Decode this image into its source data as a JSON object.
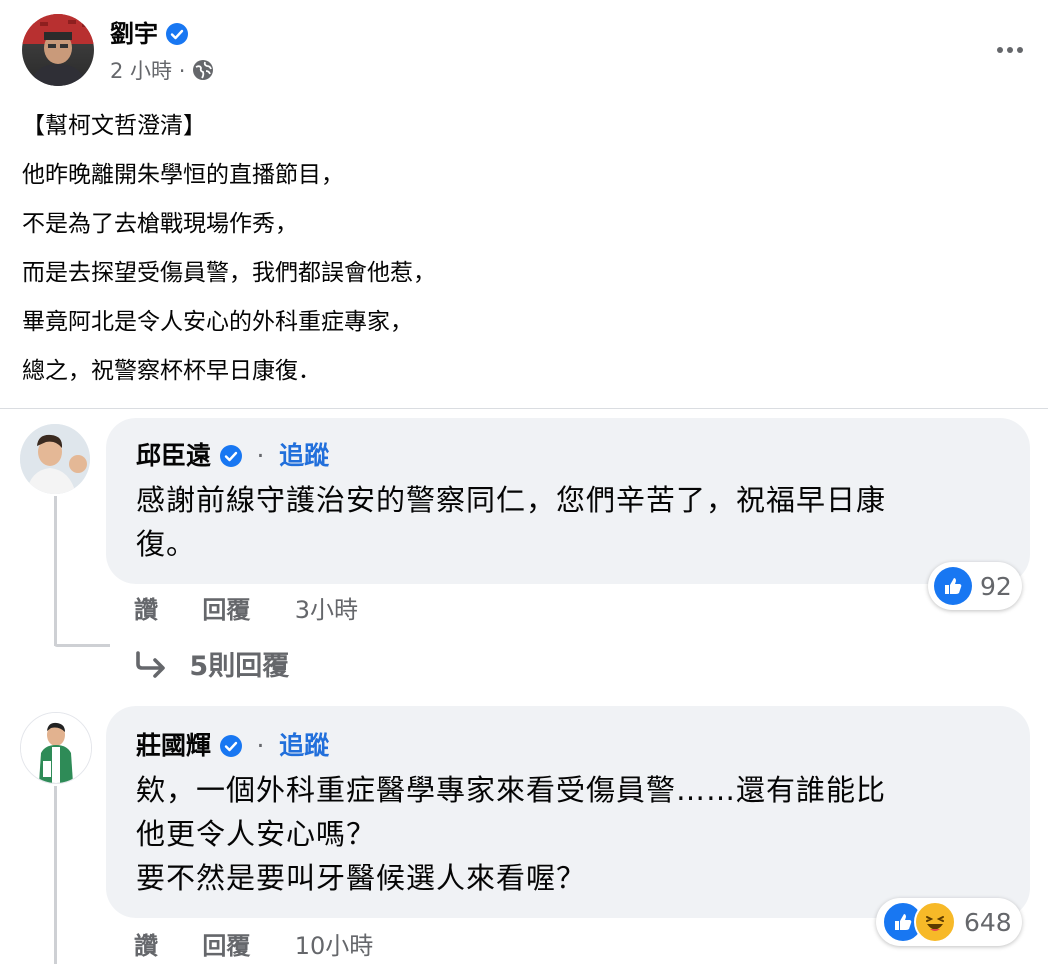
{
  "post": {
    "author": "劉宇",
    "time": "2 小時",
    "meta_sep": "·",
    "lines": [
      "【幫柯文哲澄清】",
      "他昨晚離開朱學恒的直播節目，",
      "不是為了去槍戰現場作秀，",
      "而是去探望受傷員警，我們都誤會他惹，",
      "畢竟阿北是令人安心的外科重症專家，",
      "總之，祝警察杯杯早日康復．"
    ]
  },
  "comments": [
    {
      "name": "邱臣遠",
      "sep": "·",
      "follow": "追蹤",
      "lines": [
        "感謝前線守護治安的警察同仁，您們辛苦了，祝福早日康",
        "復。"
      ],
      "like": "讚",
      "reply": "回覆",
      "time": "3小時",
      "reaction_count": "92",
      "replies_label": "5則回覆"
    },
    {
      "name": "莊國輝",
      "sep": "·",
      "follow": "追蹤",
      "lines": [
        "欸，一個外科重症醫學專家來看受傷員警……還有誰能比",
        "他更令人安心嗎？",
        "要不然是要叫牙醫候選人來看喔？"
      ],
      "like": "讚",
      "reply": "回覆",
      "time": "10小時",
      "reaction_count": "648"
    }
  ],
  "colors": {
    "accent": "#216fdb",
    "verified": "#1877f2",
    "bubble": "#f0f2f5",
    "muted": "#65676b"
  }
}
